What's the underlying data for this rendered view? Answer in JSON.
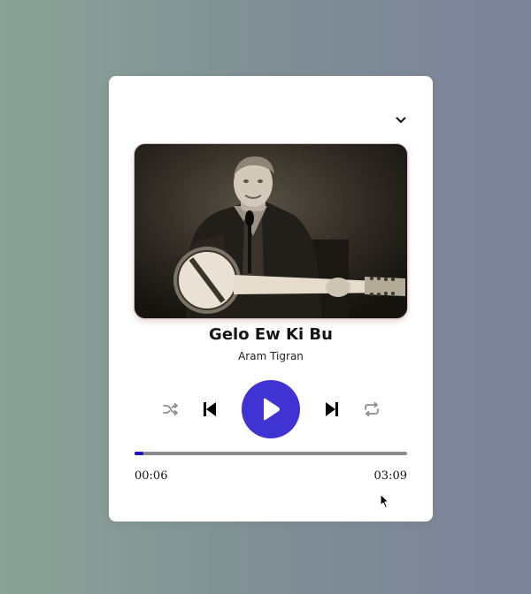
{
  "player": {
    "song_title": "Gelo Ew Ki Bu",
    "artist": "Aram Tigran",
    "current_time": "00:06",
    "total_time": "03:09",
    "progress_fraction": 0.034,
    "accent_color": "#3f33d4",
    "progress_color": "#1a13c8"
  },
  "icons": {
    "collapse": "chevron-down-icon",
    "shuffle": "shuffle-icon",
    "previous": "skip-previous-icon",
    "play": "play-icon",
    "next": "skip-next-icon",
    "repeat": "repeat-icon"
  }
}
